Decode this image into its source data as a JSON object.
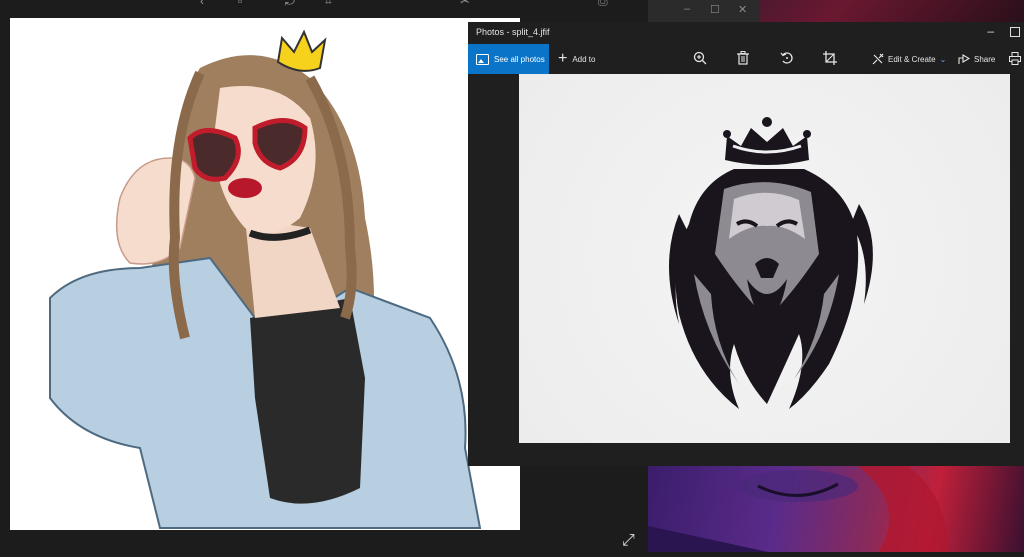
{
  "photos_window": {
    "title": "Photos - split_4.jfif",
    "toolbar": {
      "see_all_photos": "See all photos",
      "add_to": "Add to",
      "edit_create": "Edit & Create",
      "share": "Share",
      "icons": [
        "zoom-icon",
        "delete-icon",
        "rotate-icon",
        "crop-icon",
        "edit-icon",
        "share-icon",
        "print-icon"
      ]
    },
    "image_subject": "crowned lion head logo"
  },
  "left_image": {
    "subject": "illustrated woman with crown, heart sunglasses and denim jacket"
  },
  "colors": {
    "accent": "#0a74c8",
    "window_bg": "#1f1f1f",
    "canvas_bg": "#efefef"
  }
}
